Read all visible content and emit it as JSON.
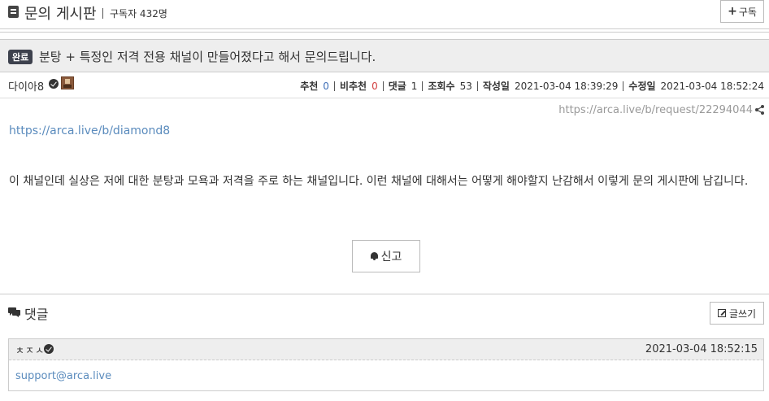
{
  "header": {
    "board_title": "문의 게시판",
    "subscribers": "구독자 432명",
    "subscribe_label": "구독"
  },
  "post": {
    "badge": "완료",
    "title": "분탕 + 특정인 저격 전용 채널이 만들어졌다고 해서 문의드립니다.",
    "author": "다이아8",
    "stats": {
      "upvote_label": "추천",
      "upvote_count": "0",
      "downvote_label": "비추천",
      "downvote_count": "0",
      "comments_label": "댓글",
      "comments_count": "1",
      "views_label": "조회수",
      "views_count": "53",
      "created_label": "작성일",
      "created_at": "2021-03-04 18:39:29",
      "modified_label": "수정일",
      "modified_at": "2021-03-04 18:52:24"
    },
    "url": "https://arca.live/b/request/22294044",
    "body_link": "https://arca.live/b/diamond8",
    "body_text": "이 채널인데 실상은 저에 대한 분탕과 모욕과 저격을 주로 하는 채널입니다. 이런 채널에 대해서는 어떻게 해야할지 난감해서 이렇게 문의 게시판에 남깁니다.",
    "report_label": "신고"
  },
  "comments": {
    "title": "댓글",
    "write_label": "글쓰기",
    "items": [
      {
        "author": "ㅊㅈㅅ",
        "time": "2021-03-04 18:52:15",
        "body": "support@arca.live"
      }
    ]
  },
  "icons": {
    "board": "board-icon",
    "verified": "verified-icon",
    "share": "share-icon",
    "bell": "bell-icon",
    "comment": "comment-icon",
    "pencil": "pencil-icon"
  },
  "colors": {
    "badge_bg": "#3d414d",
    "link": "#5a8bbd",
    "upvote": "#3f6fb7",
    "downvote": "#d24040",
    "title_bar_bg": "#eeeeee"
  }
}
